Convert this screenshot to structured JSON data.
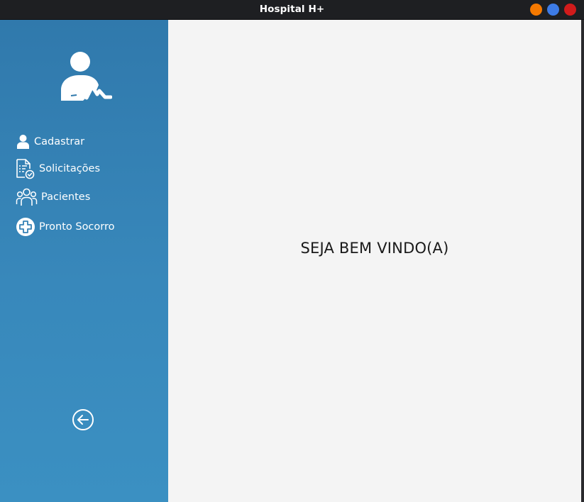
{
  "window": {
    "title": "Hospital H+",
    "controls": {
      "minimize_color": "#f57900",
      "maximize_color": "#3d7be6",
      "close_color": "#d11b1b"
    }
  },
  "sidebar": {
    "logo_icon": "doctor-heartbeat-icon",
    "items": [
      {
        "label": "Cadastrar",
        "icon": "user-icon"
      },
      {
        "label": "Solicitações",
        "icon": "document-check-icon"
      },
      {
        "label": "Pacientes",
        "icon": "group-icon"
      },
      {
        "label": "Pronto Socorro",
        "icon": "medical-cross-icon"
      }
    ],
    "back_icon": "arrow-left-circle-icon"
  },
  "main": {
    "welcome_text": "SEJA BEM VINDO(A)"
  }
}
